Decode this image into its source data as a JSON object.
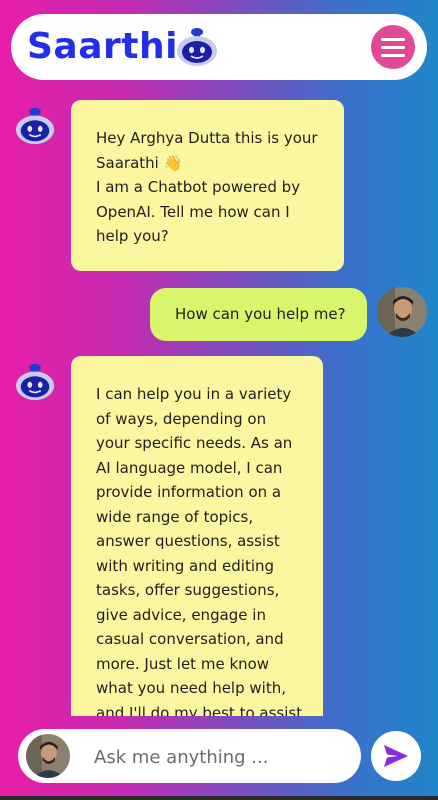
{
  "header": {
    "title": "Saarthi"
  },
  "messages": [
    {
      "sender": "bot",
      "text": "Hey Arghya Dutta this is your Saarathi 👋\nI am a Chatbot powered by OpenAI. Tell me how can I help you?"
    },
    {
      "sender": "user",
      "text": "How can you help me?"
    },
    {
      "sender": "bot",
      "text": "I can help you in a variety of ways, depending on your specific needs. As an AI language model, I can provide information on a wide range of topics, answer questions, assist with writing and editing tasks, offer suggestions, give advice, engage in casual conversation, and more. Just let me know what you need help with, and I'll do my best to assist"
    }
  ],
  "input": {
    "placeholder": "Ask me anything ..."
  },
  "colors": {
    "brand": "#2130e8",
    "menu": "#e14995",
    "bot_bubble": "#fbf6a0",
    "user_bubble": "#d8f56b",
    "send": "#8a2be2"
  },
  "icons": {
    "brand": "robot-icon",
    "menu": "hamburger-menu-icon",
    "send": "send-icon"
  }
}
